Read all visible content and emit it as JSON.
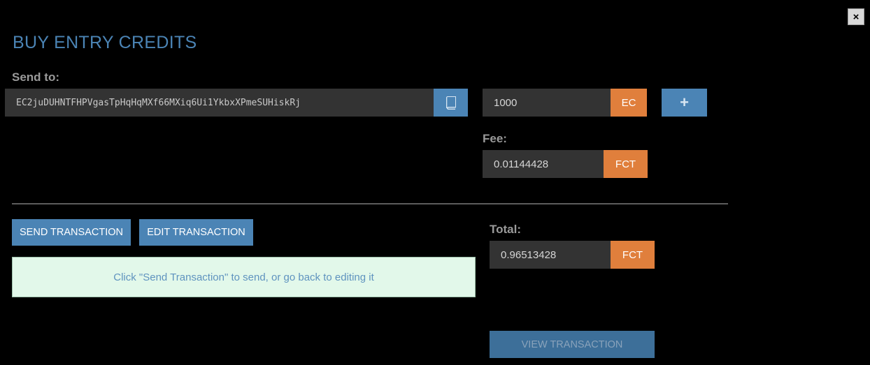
{
  "dialog": {
    "title": "BUY ENTRY CREDITS",
    "close_label": "×"
  },
  "send_to": {
    "label": "Send to:",
    "address": "EC2juDUHNTFHPVgasTpHqHqMXf66MXiq6Ui1YkbxXPmeSUHiskRj",
    "address_book_icon": "address-book-icon"
  },
  "amount": {
    "value": "1000",
    "unit": "EC",
    "add_label": "+"
  },
  "fee": {
    "label": "Fee:",
    "value": "0.01144428",
    "unit": "FCT"
  },
  "actions": {
    "send_label": "SEND TRANSACTION",
    "edit_label": "EDIT TRANSACTION",
    "notice": "Click \"Send Transaction\" to send, or go back to editing it",
    "view_label": "VIEW TRANSACTION"
  },
  "total": {
    "label": "Total:",
    "value": "0.96513428",
    "unit": "FCT"
  },
  "colors": {
    "accent_blue": "#4b84b5",
    "accent_orange": "#e07f3c",
    "field_bg": "#333333",
    "notice_bg": "#e2f8ea"
  }
}
